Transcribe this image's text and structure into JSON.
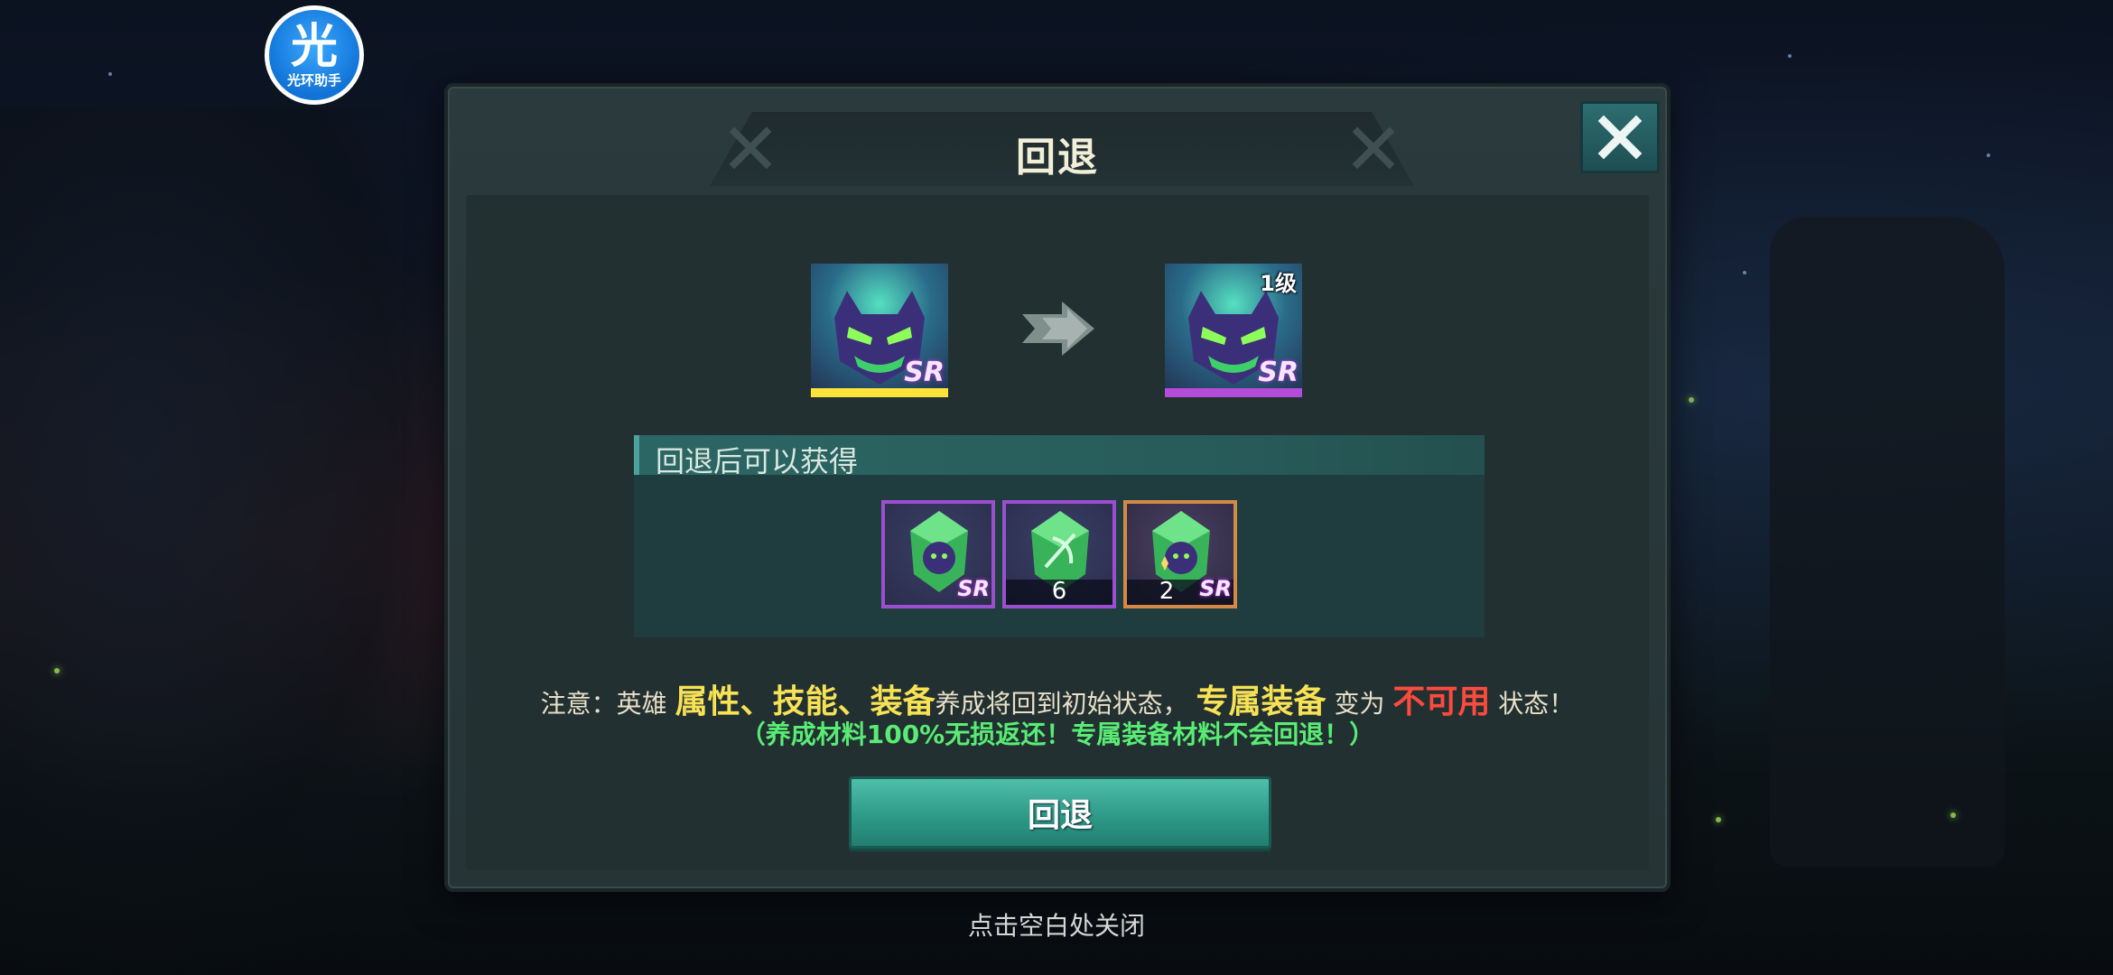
{
  "watermark": {
    "glyph": "光",
    "text": "光环助手"
  },
  "dialog": {
    "title": "回退",
    "close_icon": "close-icon",
    "hero_before": {
      "rarity": "SR",
      "bar_color": "#ffe23a"
    },
    "hero_after": {
      "rarity": "SR",
      "level": "1级",
      "bar_color": "#b34cd8"
    },
    "rewards_header": "回退后可以获得",
    "rewards": [
      {
        "name": "hero-shard",
        "rarity": "SR",
        "count": "",
        "frame": "purple"
      },
      {
        "name": "bow-gem",
        "rarity": "",
        "count": "6",
        "frame": "purple"
      },
      {
        "name": "hero-shard",
        "rarity": "SR",
        "count": "2",
        "frame": "orange"
      }
    ],
    "note": {
      "prefix": "注意：英雄",
      "attributes": "属性、技能、装备",
      "middle": "养成将回到初始状态，",
      "exclusive": "专属装备",
      "becomes": "变为",
      "unusable": "不可用",
      "suffix": "状态！"
    },
    "note2": "（养成材料100%无损返还！专属装备材料不会回退！）",
    "confirm_label": "回退"
  },
  "hint": "点击空白处关闭",
  "colors": {
    "highlight": "#f7e154",
    "warning": "#ff4a3d",
    "green_note": "#59ec74",
    "button": "#2e9a88"
  }
}
